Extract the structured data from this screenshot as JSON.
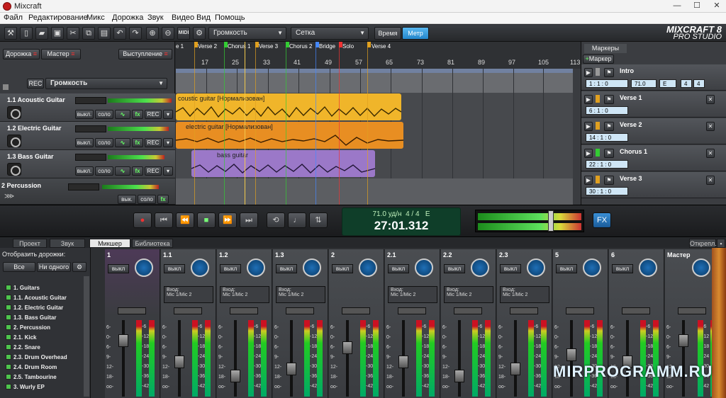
{
  "window": {
    "title": "Mixcraft",
    "min": "—",
    "max": "☐",
    "close": "✕"
  },
  "menu": [
    "Файл",
    "Редактирование",
    "Микс",
    "Дорожка",
    "Звук",
    "Видео",
    "Вид",
    "Помощь"
  ],
  "toolbar": {
    "volume_label": "Громкость",
    "grid_label": "Сетка",
    "time_label": "Время",
    "metr_label": "Метр",
    "midi_label": "MIDI",
    "logo_line1": "MIXCRAFT 8",
    "logo_line2": "PRO STUDIO"
  },
  "track_header": {
    "track_btn": "Дорожка",
    "master_btn": "Мастер",
    "perform_btn": "Выступление",
    "rec_btn": "REC",
    "volume_select": "Громкость"
  },
  "tracks": [
    {
      "name": "1.1 Acoustic Guitar",
      "off": "выкл.",
      "solo": "соло",
      "fx": "fx",
      "rec": "REC"
    },
    {
      "name": "1.2 Electric Guitar",
      "off": "выкл.",
      "solo": "соло",
      "fx": "fx",
      "rec": "REC"
    },
    {
      "name": "1.3 Bass Guitar",
      "off": "выкл.",
      "solo": "соло",
      "fx": "fx",
      "rec": "REC"
    },
    {
      "name": "2 Percussion",
      "off": "вык.",
      "solo": "соло",
      "fx": "fx"
    }
  ],
  "timeline": {
    "markers": [
      "e 1",
      "Verse 2",
      "Chorus 1",
      "Verse 3",
      "Chorus 2",
      "Bridge",
      "Solo",
      "Verse 4"
    ],
    "bars": [
      "17",
      "25",
      "33",
      "41",
      "49",
      "57",
      "65",
      "73",
      "81",
      "89",
      "97",
      "105",
      "113"
    ],
    "clips": [
      "coustic guitar [Нормализован]",
      "electric guitar [Нормализован]",
      "bass guitar"
    ]
  },
  "markers_panel": {
    "title": "Маркеры",
    "add": "Маркер",
    "items": [
      {
        "name": "Intro",
        "time": "1 : 1 : 0",
        "tempo": "71.0",
        "key": "E",
        "sig1": "4",
        "sig2": "4"
      },
      {
        "name": "Verse 1",
        "time": "6 : 1 : 0"
      },
      {
        "name": "Verse 2",
        "time": "14 : 1 : 0"
      },
      {
        "name": "Chorus 1",
        "time": "22 : 1 : 0"
      },
      {
        "name": "Verse 3",
        "time": "30 : 1 : 0"
      }
    ]
  },
  "transport": {
    "tempo": "71.0 уд/н",
    "sig": "4 / 4",
    "key": "E",
    "time": "27:01.312",
    "fx": "FX"
  },
  "tabs": [
    "Проект",
    "Звук",
    "Микшер",
    "Библиотека"
  ],
  "undock": "Открепл.",
  "mixer_left": {
    "show_tracks": "Отобразить дорожки:",
    "all": "Все",
    "none": "Ни одного",
    "list": [
      "1. Guitars",
      "1.1. Acoustic Guitar",
      "1.2. Electric Guitar",
      "1.3. Bass Guitar",
      "2. Percussion",
      "2.1. Kick",
      "2.2. Snare",
      "2.3. Drum Overhead",
      "2.4. Drum Room",
      "2.5. Tambourine",
      "3. Wurly EP"
    ]
  },
  "channels": [
    {
      "label": "1",
      "off": "выкл"
    },
    {
      "label": "1.1",
      "off": "выкл",
      "input": "Вход:",
      "src": "Mic 1/Mic 2"
    },
    {
      "label": "1.2",
      "off": "выкл",
      "input": "Вход:",
      "src": "Mic 1/Mic 2"
    },
    {
      "label": "1.3",
      "off": "выкл",
      "input": "Вход:",
      "src": "Mic 1/Mic 2"
    },
    {
      "label": "2",
      "off": "выкл"
    },
    {
      "label": "2.1",
      "off": "выкл",
      "input": "Вход:",
      "src": "Mic 1/Mic 2"
    },
    {
      "label": "2.2",
      "off": "выкл",
      "input": "Вход:",
      "src": "Mic 1/Mic 2"
    },
    {
      "label": "2.3",
      "off": "выкл",
      "input": "Вход:",
      "src": "Mic 1/Mic 2"
    },
    {
      "label": "5",
      "off": "выкл"
    },
    {
      "label": "6",
      "off": "выкл"
    },
    {
      "label": "Мастер"
    }
  ],
  "scale_left": [
    "6-",
    "0-",
    "6-",
    "9-",
    "12-",
    "18-",
    "oo-"
  ],
  "scale_right": [
    "-6",
    "-12",
    "-18",
    "-24",
    "-30",
    "-36",
    "-42"
  ],
  "watermark": "MIRPROGRAMM.RU"
}
